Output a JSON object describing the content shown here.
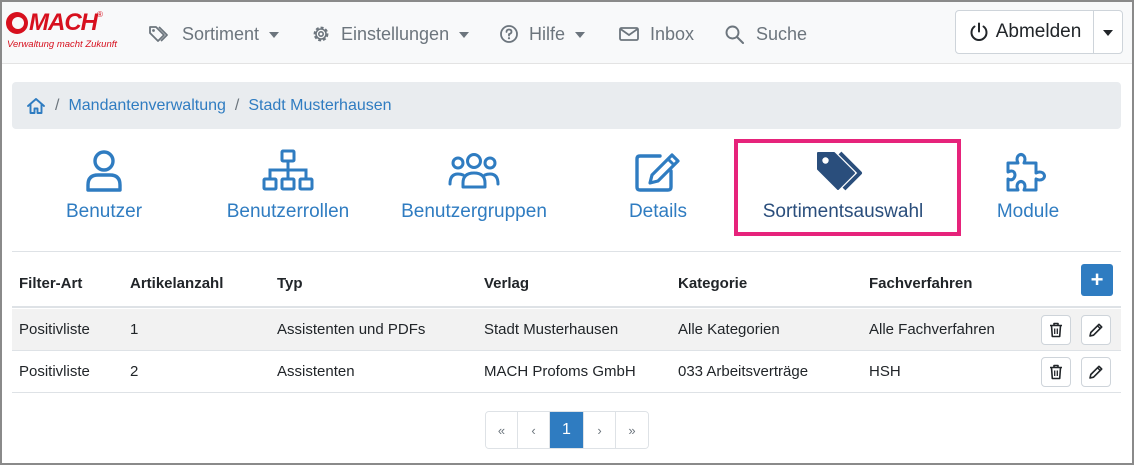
{
  "brand": {
    "name": "MACH",
    "registered": "®",
    "tagline": "Verwaltung macht Zukunft"
  },
  "nav": {
    "items": [
      {
        "label": "Sortiment",
        "icon": "tags-icon",
        "dropdown": true
      },
      {
        "label": "Einstellungen",
        "icon": "gear-icon",
        "dropdown": true
      },
      {
        "label": "Hilfe",
        "icon": "question-circle-icon",
        "dropdown": true
      },
      {
        "label": "Inbox",
        "icon": "envelope-icon",
        "dropdown": false
      },
      {
        "label": "Suche",
        "icon": "search-icon",
        "dropdown": false
      }
    ],
    "logout_label": "Abmelden"
  },
  "breadcrumb": {
    "items": [
      "Mandantenverwaltung",
      "Stadt Musterhausen"
    ],
    "separator": "/"
  },
  "tabs": [
    {
      "label": "Benutzer",
      "icon": "user-icon",
      "active": false
    },
    {
      "label": "Benutzerrollen",
      "icon": "sitemap-icon",
      "active": false
    },
    {
      "label": "Benutzergruppen",
      "icon": "users-icon",
      "active": false
    },
    {
      "label": "Details",
      "icon": "edit-icon",
      "active": false
    },
    {
      "label": "Sortimentsauswahl",
      "icon": "tags-icon",
      "active": true
    },
    {
      "label": "Module",
      "icon": "puzzle-icon",
      "active": false
    }
  ],
  "table": {
    "headers": [
      "Filter-Art",
      "Artikelanzahl",
      "Typ",
      "Verlag",
      "Kategorie",
      "Fachverfahren"
    ],
    "add_label": "+",
    "rows": [
      [
        "Positivliste",
        "1",
        "Assistenten und PDFs",
        "Stadt Musterhausen",
        "Alle Kategorien",
        "Alle Fachverfahren"
      ],
      [
        "Positivliste",
        "2",
        "Assistenten",
        "MACH Profoms GmbH",
        "033 Arbeitsverträge",
        "HSH"
      ]
    ]
  },
  "pagination": {
    "first": "«",
    "prev": "‹",
    "current": "1",
    "next": "›",
    "last": "»"
  },
  "colors": {
    "brand_red": "#d7101e",
    "link_blue": "#2f7cc1",
    "active_tab": "#2a4e7c",
    "highlight": "#e6237b"
  }
}
